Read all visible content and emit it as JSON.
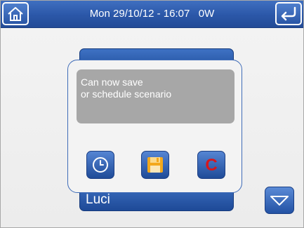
{
  "header": {
    "status_text": "Mon 29/10/12 - 16:07   0W",
    "home_icon": "home-icon",
    "back_icon": "back-arrow-icon"
  },
  "list": {
    "bottom_label": "Luci"
  },
  "popup": {
    "message_line1": "Can now save",
    "message_line2": "or schedule scenario",
    "schedule_icon": "clock-icon",
    "save_icon": "floppy-disk-icon",
    "cancel_glyph": "C"
  },
  "nav": {
    "scroll_down_icon": "triangle-down-icon"
  },
  "colors": {
    "accent": "#2b57a8",
    "popup_border": "#3f6cb8",
    "message_bg": "#a7a7a7",
    "cancel_red": "#d7161c",
    "save_orange": "#f3a81c"
  }
}
